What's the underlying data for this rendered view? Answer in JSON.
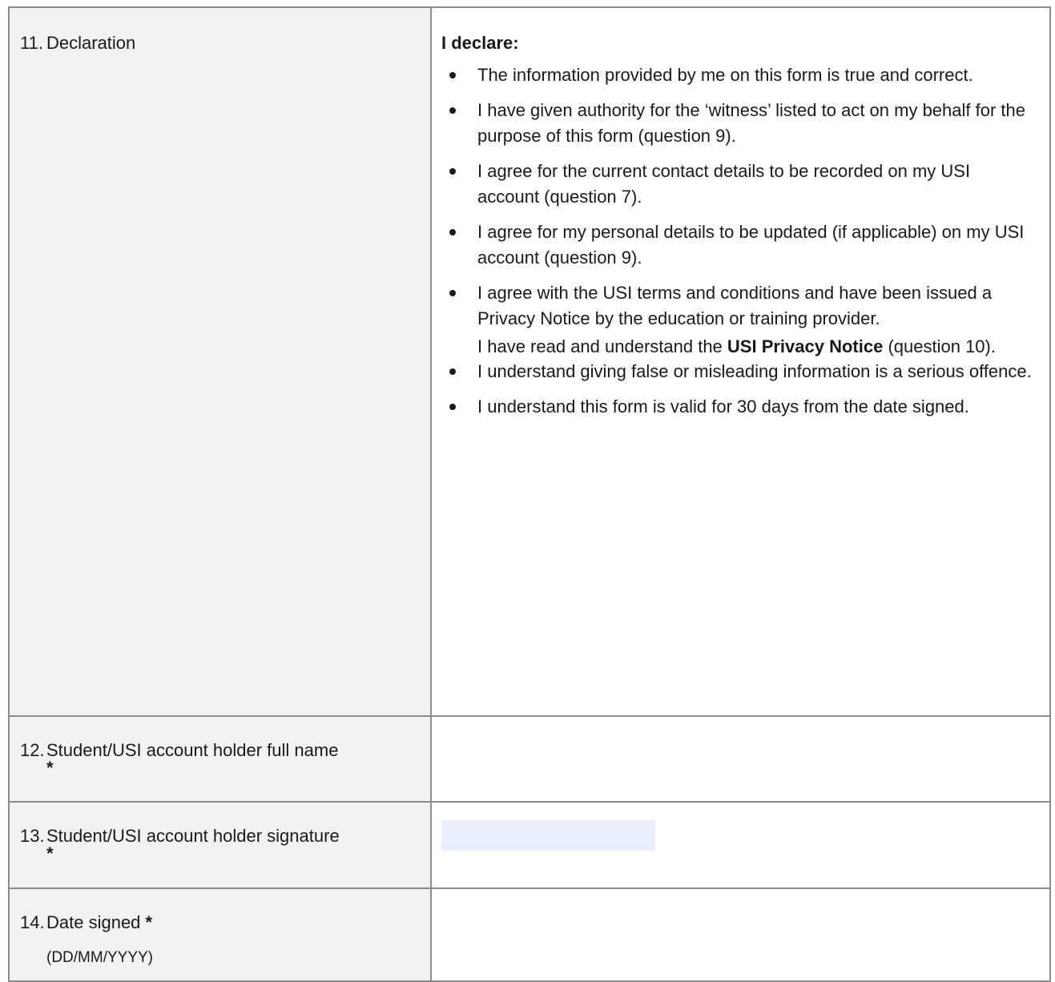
{
  "declaration": {
    "number": "11.",
    "label": "Declaration",
    "heading": "I declare:",
    "items": [
      "The information provided by me on this form is true and correct.",
      "I have given authority for the ‘witness’ listed to act on my behalf for the purpose of this form (question 9).",
      "I agree for the current contact details to be recorded on my USI account (question 7).",
      "I agree for my personal details to be updated (if applicable) on my USI account (question 9).",
      "I agree with the USI terms and conditions and have been issued a Privacy Notice by the education or training provider."
    ],
    "privacy_para": {
      "prefix": "I have read and understand the ",
      "link_text": "USI Privacy Notice",
      "suffix": " (question 10)."
    },
    "items_after": [
      "I understand giving false or misleading information is a serious offence.",
      "I understand this form is valid for 30 days from the date signed."
    ]
  },
  "full_name": {
    "number": "12.",
    "label": "Student/USI account holder full name",
    "required": "*",
    "value": ""
  },
  "signature": {
    "number": "13.",
    "label": "Student/USI account holder signature",
    "required": "*"
  },
  "date_signed": {
    "number": "14.",
    "label": "Date signed",
    "required": "*",
    "hint": "(DD/MM/YYYY)",
    "value": ""
  }
}
